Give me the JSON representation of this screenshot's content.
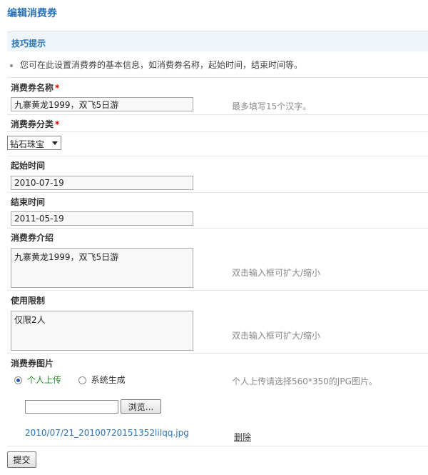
{
  "page": {
    "title": "编辑消费券"
  },
  "tips": {
    "header": "技巧提示",
    "line": "您可在此设置消费券的基本信息，如消费券名称，起始时间，结束时间等。"
  },
  "form": {
    "name": {
      "label": "消费券名称",
      "required_mark": "*",
      "value": "九寨黄龙1999，双飞5日游",
      "hint": "最多填写15个汉字。"
    },
    "category": {
      "label": "消费券分类",
      "required_mark": "*",
      "selected": "钻石珠宝"
    },
    "start_time": {
      "label": "起始时间",
      "value": "2010-07-19"
    },
    "end_time": {
      "label": "结束时间",
      "value": "2011-05-19"
    },
    "intro": {
      "label": "消费券介绍",
      "value": "九寨黄龙1999，双飞5日游",
      "hint": "双击输入框可扩大/缩小"
    },
    "limit": {
      "label": "使用限制",
      "value": "仅限2人",
      "hint": "双击输入框可扩大/缩小"
    },
    "image": {
      "label": "消费券图片",
      "options": [
        "个人上传",
        "系统生成"
      ],
      "selected_index": 0,
      "hint": "个人上传请选择560*350的JPG图片。",
      "browse_label": "浏览...",
      "file_name": "2010/07/21_20100720151352liIqq.jpg",
      "delete_label": "删除"
    },
    "submit_label": "提交"
  },
  "colors": {
    "accent": "#2a72b5",
    "tip_bg": "#eef5fb",
    "required": "#dd0000",
    "radio_on": "#2a8a2a"
  }
}
